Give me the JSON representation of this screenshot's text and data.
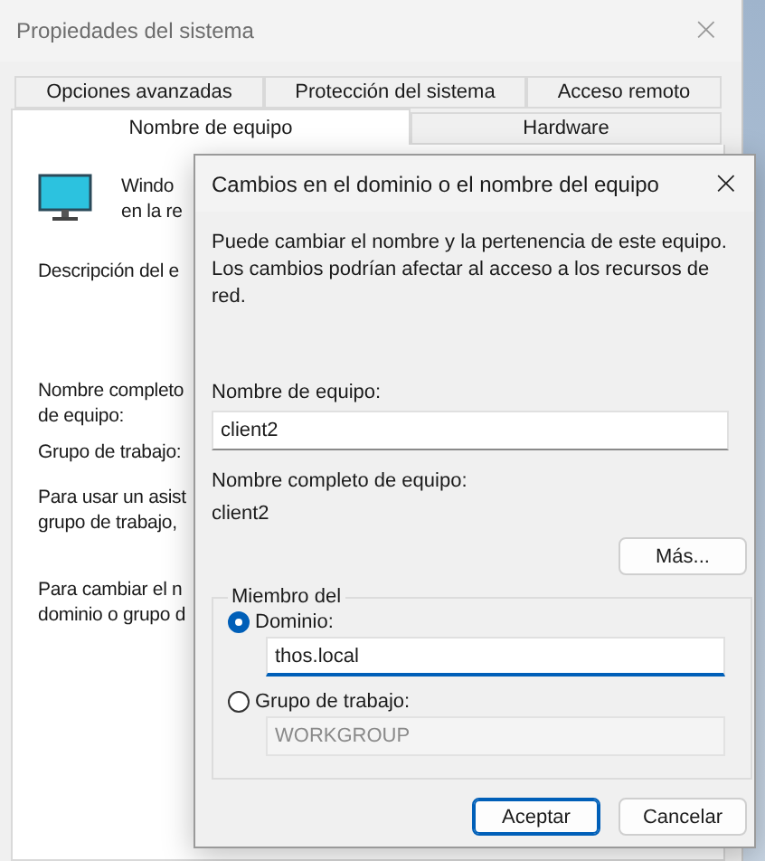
{
  "window": {
    "title": "Propiedades del sistema",
    "close": "×"
  },
  "tabs": [
    {
      "label": "Opciones avanzadas",
      "selected": false
    },
    {
      "label": "Protección del sistema",
      "selected": false
    },
    {
      "label": "Acceso remoto",
      "selected": false
    },
    {
      "label": "Nombre de equipo",
      "selected": true
    },
    {
      "label": "Hardware",
      "selected": false
    }
  ],
  "panel": {
    "intro_lines": [
      "Windo",
      "en la re"
    ],
    "description_label": "Descripción del e",
    "full_name_label_lines": [
      "Nombre completo",
      "de equipo:"
    ],
    "workgroup_label": "Grupo de trabajo:",
    "wizard_lines": [
      "Para usar un asist",
      "grupo de trabajo,"
    ],
    "change_lines": [
      "Para cambiar el n",
      "dominio o grupo d"
    ]
  },
  "dialog": {
    "title": "Cambios en el dominio o el nombre del equipo",
    "close": "×",
    "description": "Puede cambiar el nombre y la pertenencia de este equipo. Los cambios podrían afectar al acceso a los recursos de red.",
    "computer_name_label": "Nombre de equipo:",
    "computer_name": "client2",
    "full_name_label": "Nombre completo de equipo:",
    "full_name": "client2",
    "more_button": "Más...",
    "member_of": {
      "legend": "Miembro del",
      "options": [
        {
          "label": "Dominio:",
          "selected": true,
          "value": "thos.local",
          "disabled": false
        },
        {
          "label": "Grupo de trabajo:",
          "selected": false,
          "value": "WORKGROUP",
          "disabled": true
        }
      ]
    },
    "buttons": [
      {
        "label": "Aceptar",
        "default": true
      },
      {
        "label": "Cancelar",
        "default": false
      }
    ]
  }
}
